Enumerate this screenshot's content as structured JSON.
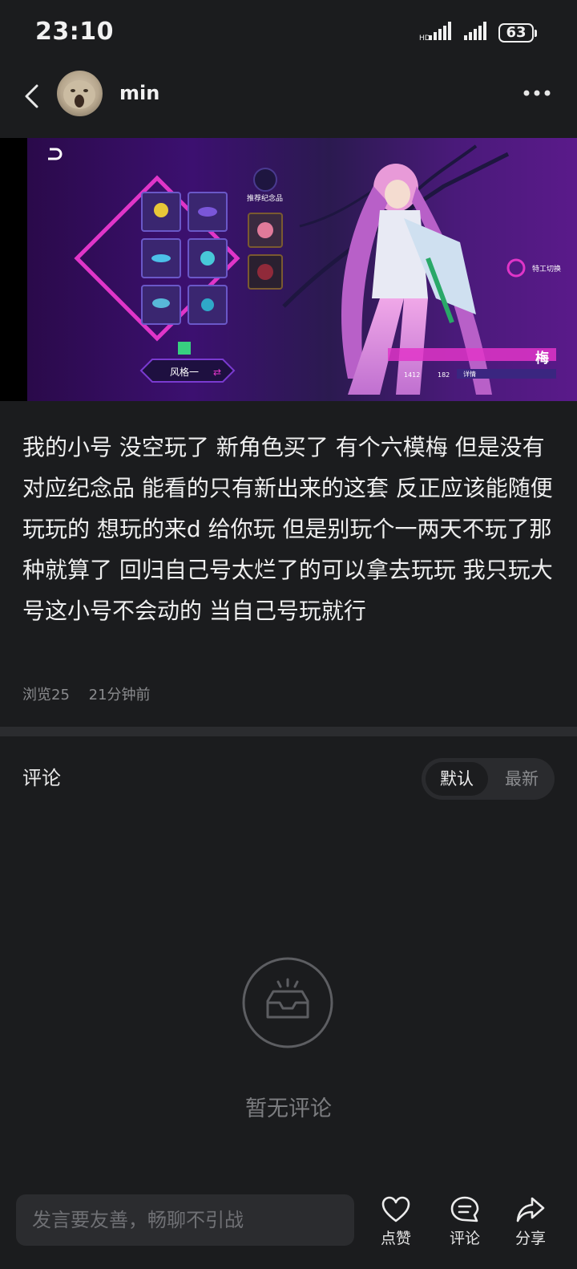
{
  "status_bar": {
    "time": "23:10",
    "battery": "63"
  },
  "header": {
    "username": "min"
  },
  "media": {
    "style_label": "风格一",
    "souvenir_title": "推荐纪念品",
    "character_name": "梅",
    "switch_label": "特工切换",
    "like_count": "1412",
    "tag_count": "182",
    "detail_label": "详情"
  },
  "post": {
    "text": "我的小号 没空玩了 新角色买了  有个六模梅 但是没有对应纪念品 能看的只有新出来的这套 反正应该能随便玩玩的 想玩的来d 给你玩 但是别玩个一两天不玩了那种就算了 回归自己号太烂了的可以拿去玩玩 我只玩大号这小号不会动的 当自己号玩就行",
    "views": "浏览25",
    "time_ago": "21分钟前"
  },
  "comments": {
    "title": "评论",
    "sort_default": "默认",
    "sort_latest": "最新",
    "empty_text": "暂无评论"
  },
  "bottom_bar": {
    "input_placeholder": "发言要友善，畅聊不引战",
    "like_label": "点赞",
    "comment_label": "评论",
    "share_label": "分享"
  }
}
